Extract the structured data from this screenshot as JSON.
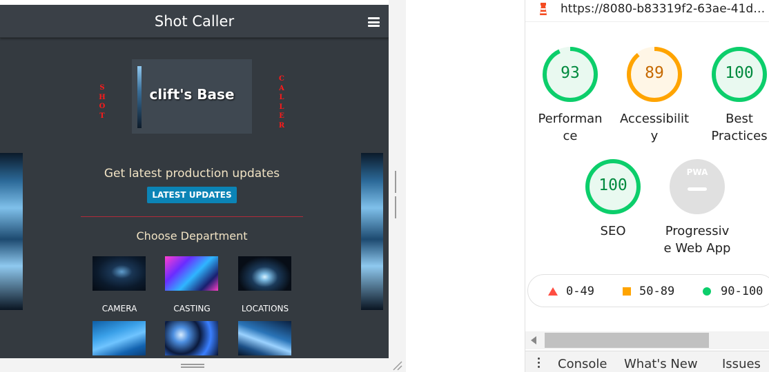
{
  "app": {
    "title": "Shot Caller",
    "side_left": "SHOT",
    "side_right": "CALLER",
    "base_title": "clift's Base",
    "updates_text": "Get latest production updates",
    "updates_button": "LATEST UPDATES",
    "department_title": "Choose Department",
    "departments": [
      "CAMERA",
      "CASTING",
      "LOCATIONS"
    ]
  },
  "lighthouse": {
    "url": "https://8080-b83319f2-63ae-41d…",
    "scores": [
      {
        "value": "93",
        "label_1": "Performan",
        "label_2": "ce",
        "score": 0.93,
        "color": "#0cce6b",
        "fill": "#e9f9f0"
      },
      {
        "value": "89",
        "label_1": "Accessibilit",
        "label_2": "y",
        "score": 0.89,
        "color": "#ffa400",
        "fill": "#fff6e6"
      },
      {
        "value": "100",
        "label_1": "Best",
        "label_2": "Practices",
        "score": 1.0,
        "color": "#0cce6b",
        "fill": "#e9f9f0"
      },
      {
        "value": "100",
        "label_1": "SEO",
        "label_2": "",
        "score": 1.0,
        "color": "#0cce6b",
        "fill": "#e9f9f0"
      },
      {
        "value": "PWA",
        "label_1": "Progressiv",
        "label_2": "e Web App",
        "score": 0,
        "color": "#9e9e9e",
        "fill": "#e0e0e0"
      }
    ],
    "legend": {
      "fail": "0-49",
      "average": "50-89",
      "pass": "90-100"
    }
  },
  "drawer": {
    "tabs": [
      "Console",
      "What's New",
      "Issues"
    ]
  },
  "colors": {
    "pass": "#0cce6b",
    "average": "#ffa400",
    "fail": "#ff4e42",
    "accent_button": "#0b84b6",
    "side_text": "#ff1a1a"
  }
}
